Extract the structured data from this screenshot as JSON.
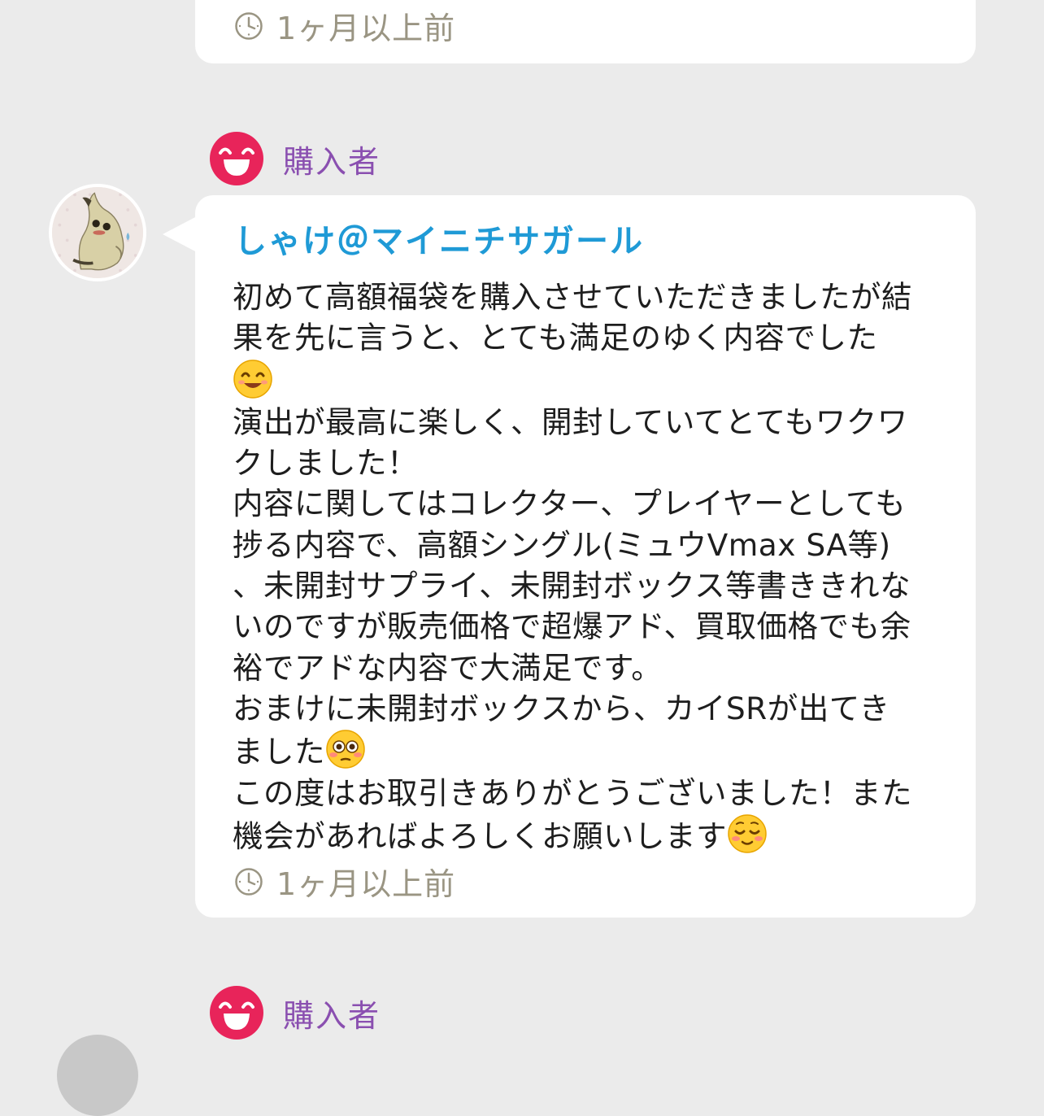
{
  "previous_review": {
    "timestamp": "1ヶ月以上前"
  },
  "review": {
    "role_label": "購入者",
    "username": "しゃけ＠マイニチサガール",
    "lines": [
      "初めて高額福袋を購入させていただきましたが結",
      "果を先に言うと、とても満足のゆく内容でした",
      "",
      "演出が最高に楽しく、開封していてとてもワクワ",
      "クしました！",
      "内容に関してはコレクター、プレイヤーとしても",
      "捗る内容で、高額シングル(ミュウVmax SA等)",
      "、未開封サプライ、未開封ボックス等書ききれな",
      "いのですが販売価格で超爆アド、買取価格でも余",
      "裕でアドな内容で大満足です。",
      "おまけに未開封ボックスから、カイSRが出てき",
      "ました",
      "この度はお取引きありがとうございました！また",
      "機会があればよろしくお願いします"
    ],
    "emojis": [
      "smiling-face-emoji",
      "flushed-face-emoji",
      "relieved-smiling-emoji"
    ],
    "timestamp": "1ヶ月以上前"
  },
  "next_review": {
    "role_label": "購入者"
  },
  "colors": {
    "background": "#ebebeb",
    "card": "#ffffff",
    "username": "#1f9ad6",
    "role_label": "#8a4fb0",
    "timestamp": "#9a9583",
    "role_icon": "#e8245a"
  }
}
